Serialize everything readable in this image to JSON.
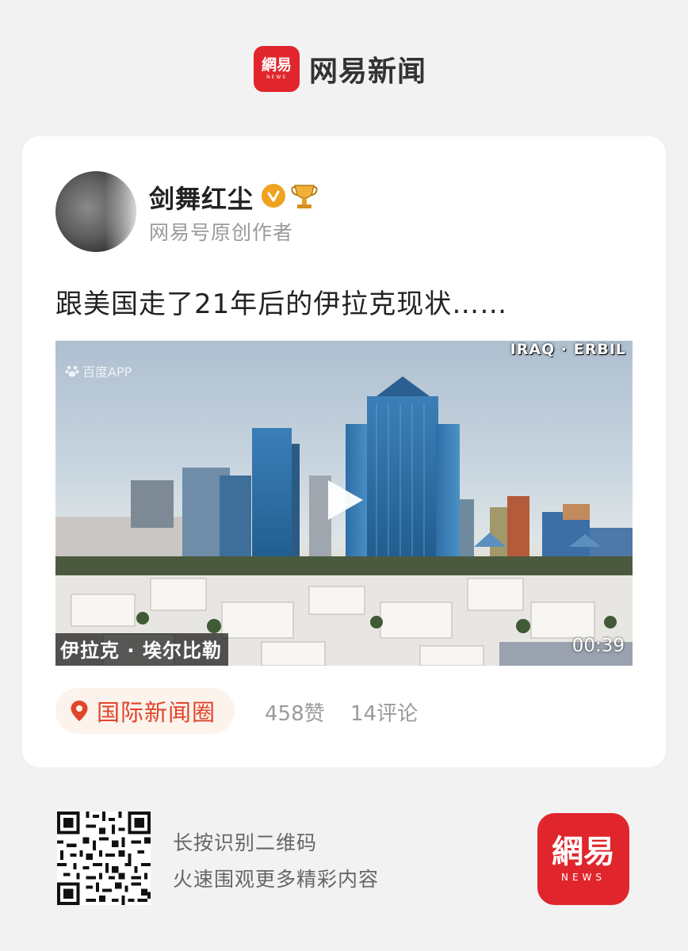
{
  "header": {
    "logo_text": "網易",
    "logo_subtext": "NEWS",
    "app_name": "网易新闻"
  },
  "post": {
    "author": {
      "name": "剑舞红尘",
      "subtitle": "网易号原创作者",
      "verified_icon": "verified-check-icon",
      "badge_icon": "trophy-icon"
    },
    "title": "跟美国走了21年后的伊拉克现状……",
    "video": {
      "watermark": "百度APP",
      "location_overlay": "IRAQ · ERBIL",
      "caption": "伊拉克 · 埃尔比勒",
      "duration": "00:39"
    },
    "topic": "国际新闻圈",
    "likes": "458赞",
    "comments": "14评论"
  },
  "footer": {
    "qr_line1": "长按识别二维码",
    "qr_line2": "火速围观更多精彩内容",
    "logo_text": "網易",
    "logo_subtext": "NEWS"
  },
  "colors": {
    "brand_red": "#e0262c",
    "topic_orange": "#e0452b",
    "verified_gold": "#f0a320"
  }
}
